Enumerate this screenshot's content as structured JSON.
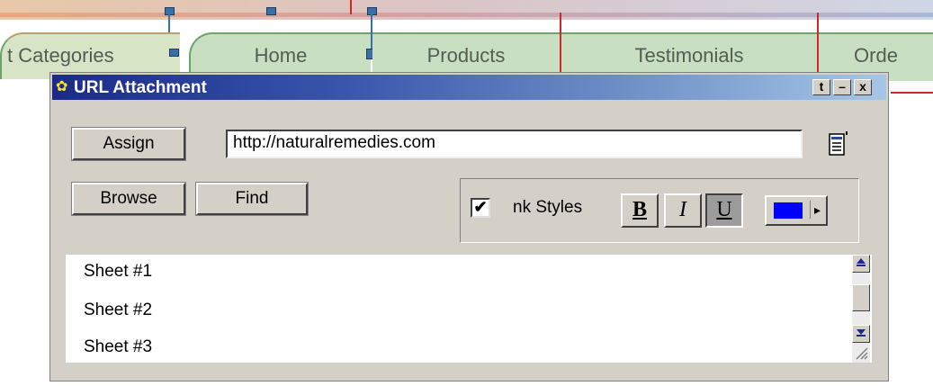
{
  "background_page": {
    "nav_tabs": [
      "t Categories",
      "Home",
      "Products",
      "Testimonials",
      "Orde"
    ]
  },
  "dialog": {
    "title": "URL Attachment",
    "title_buttons": [
      "t",
      "–",
      "x"
    ],
    "assign_label": "Assign",
    "browse_label": "Browse",
    "find_label": "Find",
    "url_value": "http://naturalremedies.com",
    "link_styles": {
      "checked": true,
      "check_mark": "✔",
      "label": "nk Styles",
      "bold_label": "B",
      "italic_label": "I",
      "underline_label": "U",
      "underline_pressed": true,
      "color": "#0000ff",
      "dropdown_arrow": "▸"
    },
    "sheets": [
      "Sheet #1",
      "Sheet #2",
      "Sheet #3"
    ]
  },
  "colors": {
    "dialog_face": "#d4d0c8",
    "titlebar_start": "#1b2a8a",
    "titlebar_end": "#a6c6e6",
    "nav_tab": "#c9dfc2",
    "nav_divider": "#d02828"
  }
}
